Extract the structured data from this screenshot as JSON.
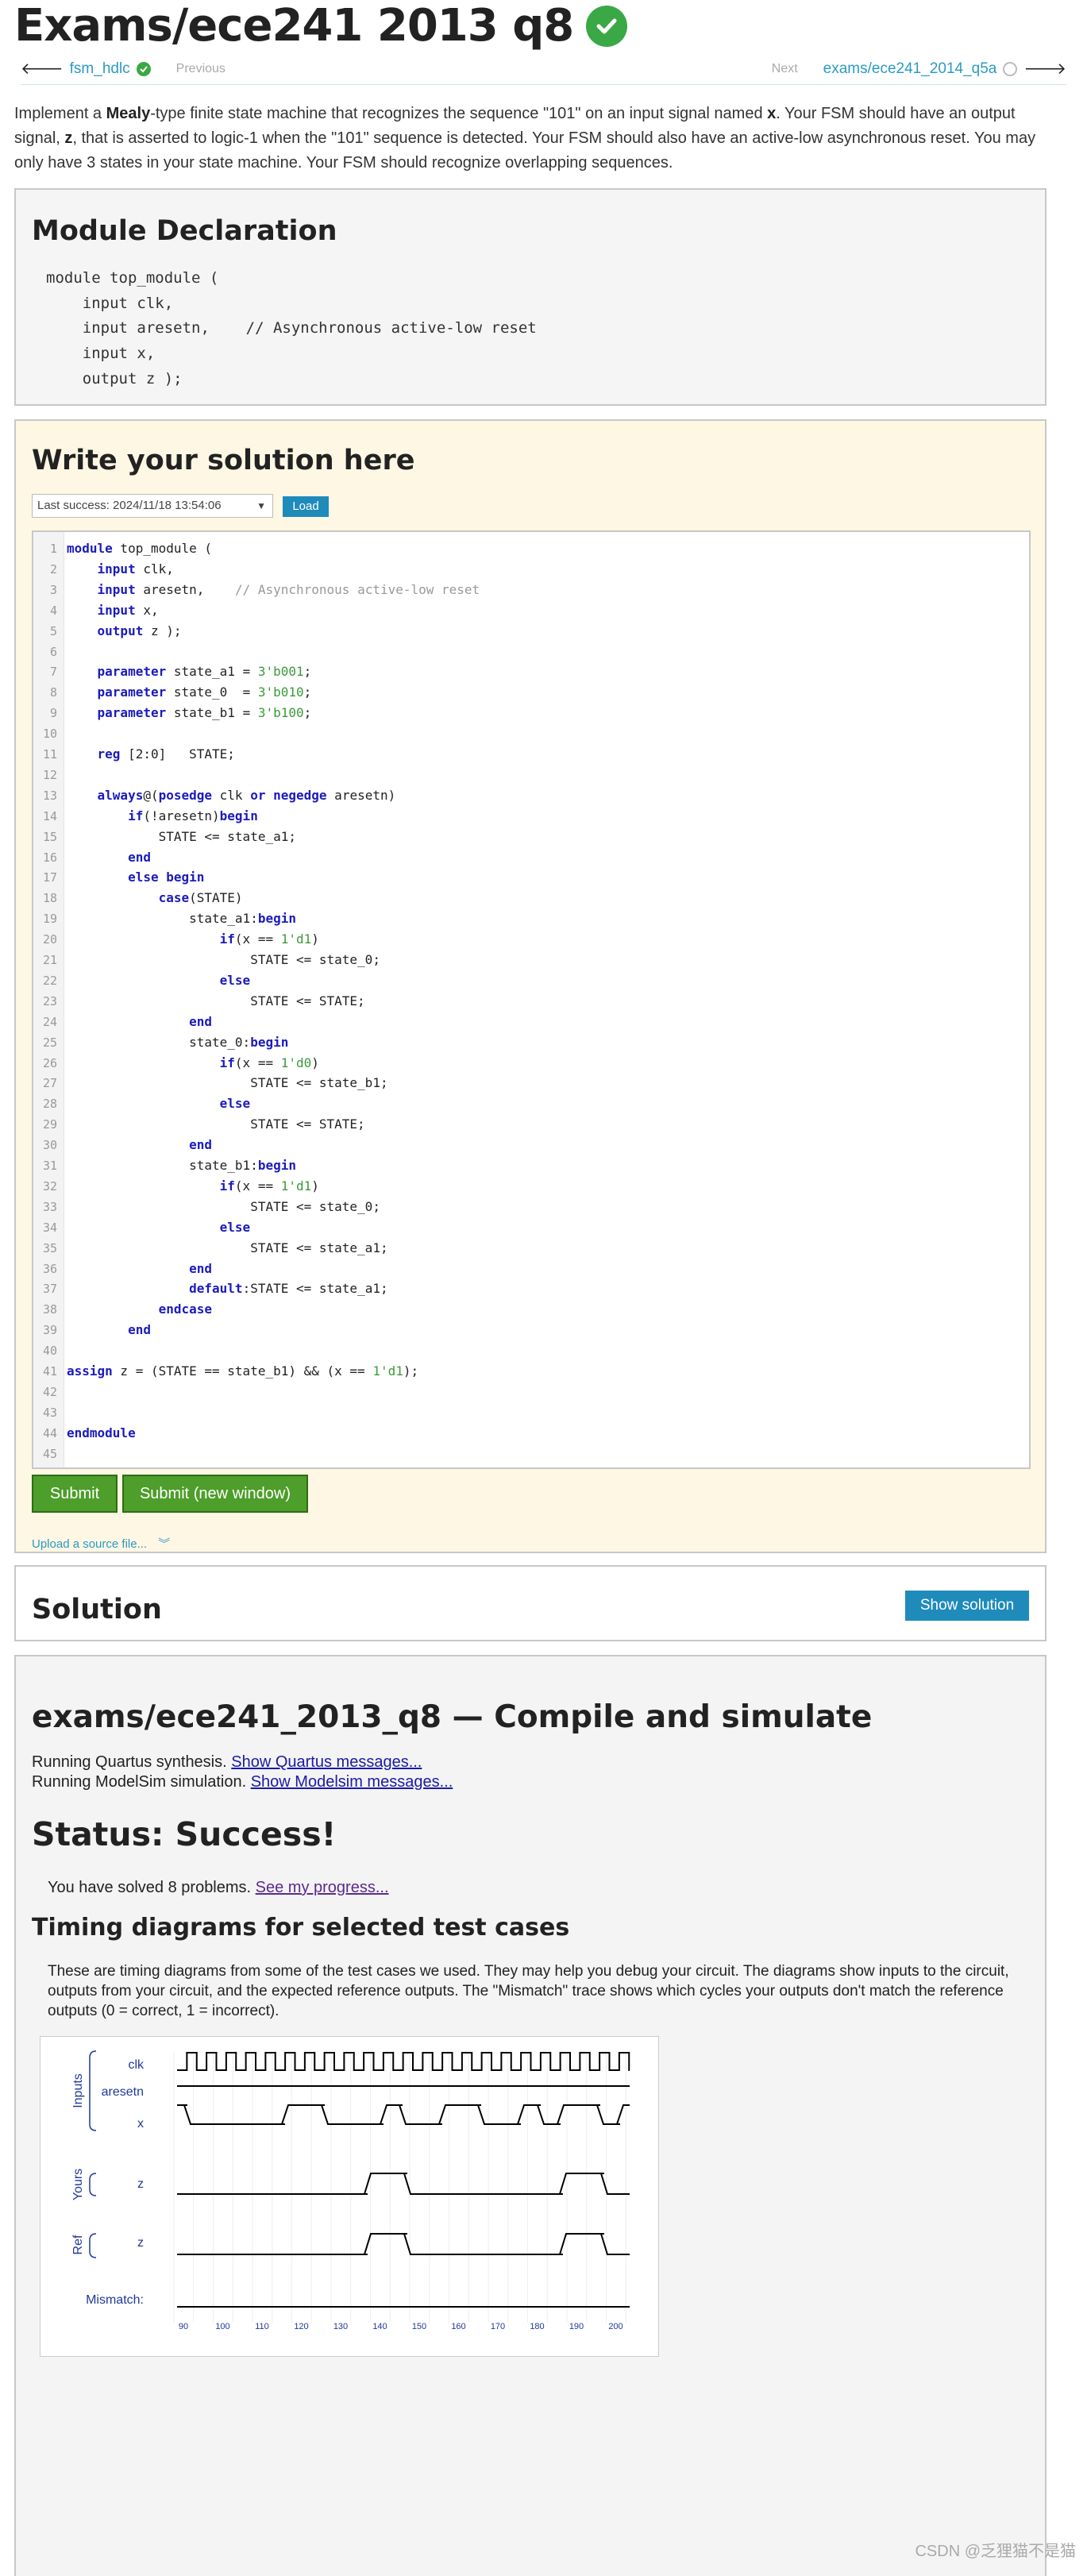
{
  "title": "Exams/ece241 2013 q8",
  "nav": {
    "prev_link": "fsm_hdlc",
    "prev_label": "Previous",
    "next_label": "Next",
    "next_link": "exams/ece241_2014_q5a"
  },
  "intro": {
    "p1": "Implement a ",
    "bold1": "Mealy",
    "p2": "-type finite state machine that recognizes the sequence \"101\" on an input signal named ",
    "bold2": "x",
    "p3": ". Your FSM should have an output signal, ",
    "bold3": "z",
    "p4": ", that is asserted to logic-1 when the \"101\" sequence is detected. Your FSM should also have an active-low asynchronous reset. You may only have 3 states in your state machine. Your FSM should recognize overlapping sequences."
  },
  "declaration": {
    "heading": "Module Declaration",
    "code": "module top_module (\n    input clk,\n    input aresetn,    // Asynchronous active-low reset\n    input x,\n    output z ); "
  },
  "editor": {
    "heading": "Write your solution here",
    "history_select": "Last success: 2024/11/18 13:54:06",
    "load_button": "Load",
    "lines": [
      "module top_module (",
      "    input clk,",
      "    input aresetn,    // Asynchronous active-low reset",
      "    input x,",
      "    output z );",
      "",
      "    parameter state_a1 = 3'b001;",
      "    parameter state_0  = 3'b010;",
      "    parameter state_b1 = 3'b100;",
      "",
      "    reg [2:0]   STATE;",
      "",
      "    always@(posedge clk or negedge aresetn)",
      "        if(!aresetn)begin",
      "            STATE <= state_a1;",
      "        end",
      "        else begin",
      "            case(STATE)",
      "                state_a1:begin",
      "                    if(x == 1'd1)",
      "                        STATE <= state_0;",
      "                    else",
      "                        STATE <= STATE;",
      "                end",
      "                state_0:begin",
      "                    if(x == 1'd0)",
      "                        STATE <= state_b1;",
      "                    else",
      "                        STATE <= STATE;",
      "                end",
      "                state_b1:begin",
      "                    if(x == 1'd1)",
      "                        STATE <= state_0;",
      "                    else",
      "                        STATE <= state_a1;",
      "                end",
      "                default:STATE <= state_a1;",
      "            endcase",
      "        end",
      "",
      "assign z = (STATE == state_b1) && (x == 1'd1);",
      "",
      "",
      "endmodule",
      ""
    ],
    "submit_button": "Submit",
    "submit_new_window_button": "Submit (new window)",
    "upload_link": "Upload a source file..."
  },
  "solution": {
    "heading": "Solution",
    "show_button": "Show solution"
  },
  "results": {
    "heading": "exams/ece241_2013_q8 — Compile and simulate",
    "quartus_text": "Running Quartus synthesis.",
    "quartus_link": "Show Quartus messages...",
    "modelsim_text": "Running ModelSim simulation.",
    "modelsim_link": "Show Modelsim messages...",
    "status": "Status: Success!",
    "solved_text": "You have solved 8 problems.",
    "progress_link": "See my progress...",
    "timing_heading": "Timing diagrams for selected test cases",
    "timing_desc": "These are timing diagrams from some of the test cases we used. They may help you debug your circuit. The diagrams show inputs to the circuit, outputs from your circuit, and the expected reference outputs. The \"Mismatch\" trace shows which cycles your outputs don't match the reference outputs (0 = correct, 1 = incorrect).",
    "waveform": {
      "groups": [
        "Inputs",
        "Yours",
        "Ref"
      ],
      "signals": [
        "clk",
        "aresetn",
        "x",
        "z",
        "z",
        "Mismatch:"
      ],
      "ticks": [
        "90",
        "100",
        "110",
        "120",
        "130",
        "140",
        "150",
        "160",
        "170",
        "180",
        "190",
        "200"
      ]
    }
  },
  "watermark": "CSDN @乏狸猫不是猫",
  "colors": {
    "link": "#2b9bc3",
    "success_green": "#3aa845",
    "submit_green": "#4d9e2a",
    "button_blue": "#1f8bbb",
    "editor_panel_bg": "#fdf7e4",
    "keyword": "#1b1bbd"
  }
}
